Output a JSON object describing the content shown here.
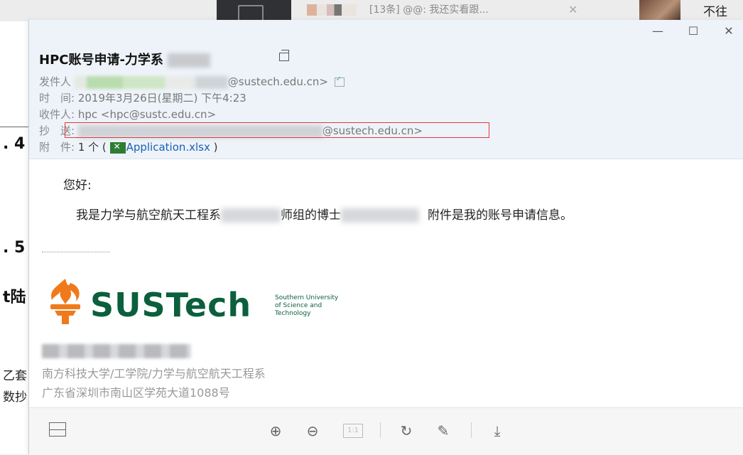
{
  "taskbar": {
    "chat_preview": "[13条] @@: 我还实看跟...",
    "right_text": "不往"
  },
  "background_doc": {
    "fragments": [
      ". 4",
      ". 5",
      "t陆",
      "乙套",
      "数抄"
    ]
  },
  "window": {
    "controls": {
      "minimize": "—",
      "maximize": "☐",
      "close": "✕"
    }
  },
  "email": {
    "subject": "HPC账号申请-力学系",
    "from_label": "发件人",
    "from_value": "@sustech.edu.cn>",
    "time_label": "时　间:",
    "time_value": "2019年3月26日(星期二) 下午4:23",
    "to_label": "收件人:",
    "to_value": "hpc <hpc@sustc.edu.cn>",
    "cc_label": "抄　送:",
    "cc_value": "@sustech.edu.cn>",
    "attach_label": "附　件:",
    "attach_count": "1 个 (",
    "attach_name": "Application.xlsx",
    "attach_close": ")"
  },
  "body": {
    "greeting": "您好:",
    "line_part1": "我是力学与航空航天工程系",
    "line_part2": "师组的博士",
    "line_part3": "附件是我的账号申请信息。"
  },
  "signature": {
    "brand": "SUSTech",
    "tagline": "Southern University\nof Science and\nTechnology",
    "dept": "南方科技大学/工学院/力学与航空航天工程系",
    "address": "广东省深圳市南山区学苑大道1088号"
  },
  "toolbar": {
    "zoom_in": "⊕",
    "zoom_out": "⊖",
    "actual_size": "1:1",
    "rotate": "↻",
    "edit": "✎",
    "download": "⤓"
  },
  "colors": {
    "header_bg": "#eef3f9",
    "highlight_box": "#e03a3a",
    "link": "#1a5fb4",
    "brand_green": "#0b5f3c",
    "brand_orange": "#f07a1a"
  }
}
